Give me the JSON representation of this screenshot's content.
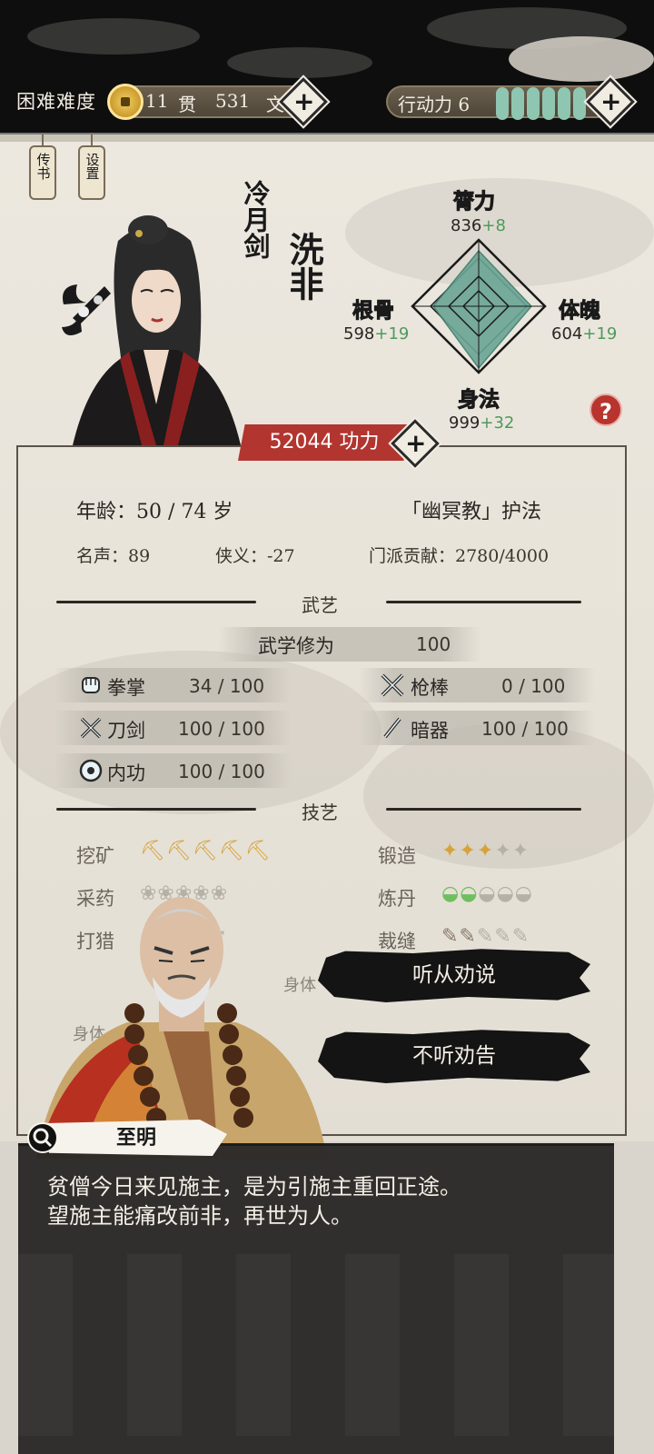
{
  "top_bar": {
    "difficulty": "困难难度",
    "money": {
      "guan_amount": "11",
      "guan_unit": "贯",
      "wen_amount": "531",
      "wen_unit": "文"
    },
    "action": {
      "label": "行动力 6",
      "pips": 6
    }
  },
  "side_tags": {
    "biography": "传书",
    "settings": "设置"
  },
  "character": {
    "title": "冷月剑",
    "name": "洗非",
    "power": "52044 功力"
  },
  "stats": {
    "strength": {
      "name": "膂力",
      "base": "836",
      "bonus": "+8",
      "color": "#c0392b"
    },
    "constitution": {
      "name": "体魄",
      "base": "604",
      "bonus": "+19",
      "color": "#3aa84a"
    },
    "agility": {
      "name": "身法",
      "base": "999",
      "bonus": "+32",
      "color": "#e6c229"
    },
    "aptitude": {
      "name": "根骨",
      "base": "598",
      "bonus": "+19",
      "color": "#3a5fc8"
    },
    "help": "?"
  },
  "profile": {
    "age": "年龄：50 / 74 岁",
    "faction": "「幽冥教」护法",
    "fame": "名声：89",
    "chivalry": "侠义：-27",
    "contribution": "门派贡献：2780/4000"
  },
  "martial": {
    "section_title": "武艺",
    "cultivation_label": "武学修为",
    "cultivation_value": "100",
    "skills": [
      {
        "name": "拳掌",
        "value": "34 / 100",
        "icon": "fist-icon"
      },
      {
        "name": "枪棒",
        "value": "0 / 100",
        "icon": "spear-icon"
      },
      {
        "name": "刀剑",
        "value": "100 / 100",
        "icon": "swords-icon"
      },
      {
        "name": "暗器",
        "value": "100 / 100",
        "icon": "dart-icon"
      },
      {
        "name": "内功",
        "value": "100 / 100",
        "icon": "qi-icon"
      }
    ]
  },
  "crafts": {
    "section_title": "技艺",
    "items": [
      {
        "name": "挖矿",
        "level": 5,
        "max": 5,
        "icon": "pickaxe-icon"
      },
      {
        "name": "锻造",
        "level": 3,
        "max": 5,
        "icon": "anvil-icon"
      },
      {
        "name": "采药",
        "level": 0,
        "max": 5,
        "icon": "herb-icon"
      },
      {
        "name": "炼丹",
        "level": 2,
        "max": 5,
        "icon": "bowl-icon"
      },
      {
        "name": "打猎",
        "level": 0,
        "max": 5,
        "icon": "arrow-icon"
      },
      {
        "name": "裁缝",
        "level": 2,
        "max": 5,
        "icon": "needle-icon"
      }
    ],
    "partial_label_1": "身体",
    "partial_label_2": "身体"
  },
  "dialog": {
    "speaker": "至明",
    "text_line1": "贫僧今日来见施主，是为引施主重回正途。",
    "text_line2": "望施主能痛改前非，再世为人。",
    "option_accept": "听从劝说",
    "option_refuse": "不听劝告"
  }
}
